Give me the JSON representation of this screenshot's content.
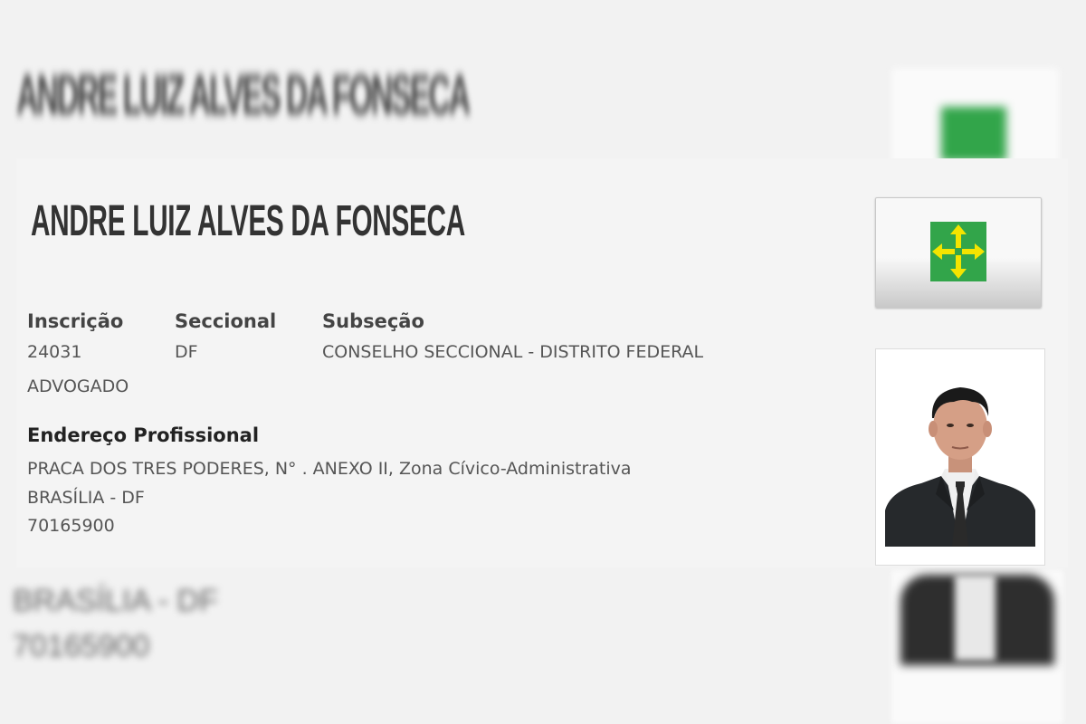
{
  "profile": {
    "name": "ANDRE LUIZ ALVES DA FONSECA",
    "inscricao_label": "Inscrição",
    "inscricao_value": "24031",
    "seccional_label": "Seccional",
    "seccional_value": "DF",
    "subsecao_label": "Subseção",
    "subsecao_value": "CONSELHO SECCIONAL - DISTRITO FEDERAL",
    "category": "ADVOGADO",
    "address_title": "Endereço Profissional",
    "address_line": "PRACA DOS TRES PODERES, N° . ANEXO II, Zona Cívico-Administrativa",
    "city": "BRASÍLIA - DF",
    "zip": "70165900"
  },
  "background": {
    "line1": "BRASÍLIA - DF",
    "line2": "70165900"
  },
  "icons": {
    "flag": "distrito-federal-flag-icon",
    "photo": "lawyer-portrait-photo"
  },
  "colors": {
    "flag_green": "#32a54a",
    "flag_yellow": "#f4e400",
    "page_bg": "#f2f2f2"
  }
}
